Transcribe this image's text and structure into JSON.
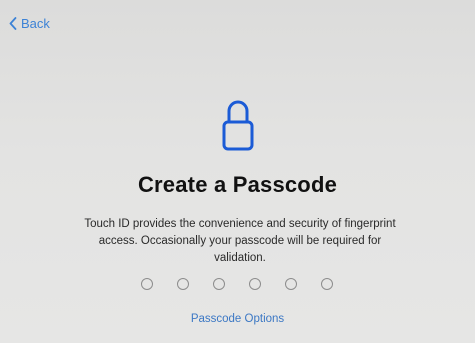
{
  "nav": {
    "back_label": "Back",
    "back_icon": "chevron-left-icon"
  },
  "main": {
    "icon": "lock-icon",
    "title": "Create a Passcode",
    "description": "Touch ID provides the convenience and security of fingerprint access. Occasionally your passcode will be required for validation.",
    "passcode_digits": 6,
    "options_label": "Passcode Options"
  },
  "colors": {
    "accent": "#3c82d6",
    "lock_icon": "#1b5bd6",
    "background": "#e3e3e2",
    "title_text": "#111111"
  }
}
